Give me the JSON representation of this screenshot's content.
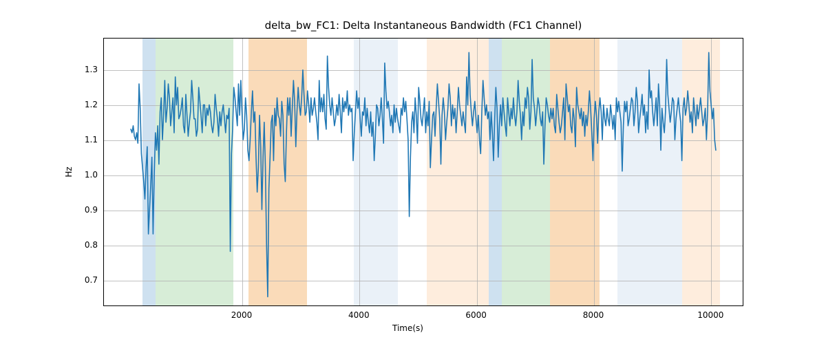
{
  "chart_data": {
    "type": "line",
    "title": "delta_bw_FC1: Delta Instantaneous Bandwidth (FC1 Channel)",
    "xlabel": "Time(s)",
    "ylabel": "Hz",
    "xlim": [
      -360,
      10560
    ],
    "ylim": [
      0.625,
      1.39
    ],
    "x_ticks": [
      2000,
      4000,
      6000,
      8000,
      10000
    ],
    "y_ticks": [
      0.7,
      0.8,
      0.9,
      1.0,
      1.1,
      1.2,
      1.3
    ],
    "x_tick_labels": [
      "2000",
      "4000",
      "6000",
      "8000",
      "10000"
    ],
    "y_tick_labels": [
      "0.7",
      "0.8",
      "0.9",
      "1.0",
      "1.1",
      "1.2",
      "1.3"
    ],
    "bands": [
      {
        "x0": 300,
        "x1": 520,
        "color": "#a6c8e4",
        "alpha": 0.55
      },
      {
        "x0": 520,
        "x1": 1850,
        "color": "#b6dfb6",
        "alpha": 0.55
      },
      {
        "x0": 2100,
        "x1": 3100,
        "color": "#f7c38b",
        "alpha": 0.6
      },
      {
        "x0": 3900,
        "x1": 4650,
        "color": "#d9e5f2",
        "alpha": 0.55
      },
      {
        "x0": 5150,
        "x1": 6200,
        "color": "#fde6cf",
        "alpha": 0.7
      },
      {
        "x0": 6200,
        "x1": 6430,
        "color": "#a6c8e4",
        "alpha": 0.55
      },
      {
        "x0": 6430,
        "x1": 7250,
        "color": "#b6dfb6",
        "alpha": 0.55
      },
      {
        "x0": 7250,
        "x1": 8100,
        "color": "#f7c38b",
        "alpha": 0.6
      },
      {
        "x0": 8400,
        "x1": 9500,
        "color": "#d9e5f2",
        "alpha": 0.55
      },
      {
        "x0": 9500,
        "x1": 10150,
        "color": "#fde6cf",
        "alpha": 0.7
      }
    ],
    "x": [
      100,
      120,
      140,
      160,
      180,
      200,
      220,
      240,
      260,
      280,
      300,
      320,
      340,
      360,
      380,
      400,
      420,
      440,
      460,
      480,
      500,
      520,
      540,
      560,
      580,
      600,
      620,
      640,
      660,
      680,
      700,
      720,
      740,
      760,
      780,
      800,
      820,
      840,
      860,
      880,
      900,
      920,
      940,
      960,
      980,
      1000,
      1020,
      1040,
      1060,
      1080,
      1100,
      1120,
      1140,
      1160,
      1180,
      1200,
      1220,
      1240,
      1260,
      1280,
      1300,
      1320,
      1340,
      1360,
      1380,
      1400,
      1420,
      1440,
      1460,
      1480,
      1500,
      1520,
      1540,
      1560,
      1580,
      1600,
      1620,
      1640,
      1660,
      1680,
      1700,
      1720,
      1740,
      1760,
      1780,
      1800,
      1820,
      1840,
      1860,
      1880,
      1900,
      1920,
      1940,
      1960,
      1980,
      2000,
      2020,
      2040,
      2060,
      2080,
      2100,
      2120,
      2140,
      2160,
      2180,
      2200,
      2220,
      2240,
      2260,
      2280,
      2300,
      2320,
      2340,
      2360,
      2380,
      2400,
      2420,
      2440,
      2460,
      2480,
      2500,
      2520,
      2540,
      2560,
      2580,
      2600,
      2620,
      2640,
      2660,
      2680,
      2700,
      2720,
      2740,
      2760,
      2780,
      2800,
      2820,
      2840,
      2860,
      2880,
      2900,
      2920,
      2940,
      2960,
      2980,
      3000,
      3020,
      3040,
      3060,
      3080,
      3100,
      3120,
      3140,
      3160,
      3180,
      3200,
      3220,
      3240,
      3260,
      3280,
      3300,
      3320,
      3340,
      3360,
      3380,
      3400,
      3420,
      3440,
      3460,
      3480,
      3500,
      3520,
      3540,
      3560,
      3580,
      3600,
      3620,
      3640,
      3660,
      3680,
      3700,
      3720,
      3740,
      3760,
      3780,
      3800,
      3820,
      3840,
      3860,
      3880,
      3900,
      3920,
      3940,
      3960,
      3980,
      4000,
      4020,
      4040,
      4060,
      4080,
      4100,
      4120,
      4140,
      4160,
      4180,
      4200,
      4220,
      4240,
      4260,
      4280,
      4300,
      4320,
      4340,
      4360,
      4380,
      4400,
      4420,
      4440,
      4460,
      4480,
      4500,
      4520,
      4540,
      4560,
      4580,
      4600,
      4620,
      4640,
      4660,
      4680,
      4700,
      4720,
      4740,
      4760,
      4780,
      4800,
      4820,
      4840,
      4860,
      4880,
      4900,
      4920,
      4940,
      4960,
      4980,
      5000,
      5020,
      5040,
      5060,
      5080,
      5100,
      5120,
      5140,
      5160,
      5180,
      5200,
      5220,
      5240,
      5260,
      5280,
      5300,
      5320,
      5340,
      5360,
      5380,
      5400,
      5420,
      5440,
      5460,
      5480,
      5500,
      5520,
      5540,
      5560,
      5580,
      5600,
      5620,
      5640,
      5660,
      5680,
      5700,
      5720,
      5740,
      5760,
      5780,
      5800,
      5820,
      5840,
      5860,
      5880,
      5900,
      5920,
      5940,
      5960,
      5980,
      6000,
      6020,
      6040,
      6060,
      6080,
      6100,
      6120,
      6140,
      6160,
      6180,
      6200,
      6220,
      6240,
      6260,
      6280,
      6300,
      6320,
      6340,
      6360,
      6380,
      6400,
      6420,
      6440,
      6460,
      6480,
      6500,
      6520,
      6540,
      6560,
      6580,
      6600,
      6620,
      6640,
      6660,
      6680,
      6700,
      6720,
      6740,
      6760,
      6780,
      6800,
      6820,
      6840,
      6860,
      6880,
      6900,
      6920,
      6940,
      6960,
      6980,
      7000,
      7020,
      7040,
      7060,
      7080,
      7100,
      7120,
      7140,
      7160,
      7180,
      7200,
      7220,
      7240,
      7260,
      7280,
      7300,
      7320,
      7340,
      7360,
      7380,
      7400,
      7420,
      7440,
      7460,
      7480,
      7500,
      7520,
      7540,
      7560,
      7580,
      7600,
      7620,
      7640,
      7660,
      7680,
      7700,
      7720,
      7740,
      7760,
      7780,
      7800,
      7820,
      7840,
      7860,
      7880,
      7900,
      7920,
      7940,
      7960,
      7980,
      8000,
      8020,
      8040,
      8060,
      8080,
      8100,
      8120,
      8140,
      8160,
      8180,
      8200,
      8220,
      8240,
      8260,
      8280,
      8300,
      8320,
      8340,
      8360,
      8380,
      8400,
      8420,
      8440,
      8460,
      8480,
      8500,
      8520,
      8540,
      8560,
      8580,
      8600,
      8620,
      8640,
      8660,
      8680,
      8700,
      8720,
      8740,
      8760,
      8780,
      8800,
      8820,
      8840,
      8860,
      8880,
      8900,
      8920,
      8940,
      8960,
      8980,
      9000,
      9020,
      9040,
      9060,
      9080,
      9100,
      9120,
      9140,
      9160,
      9180,
      9200,
      9220,
      9240,
      9260,
      9280,
      9300,
      9320,
      9340,
      9360,
      9380,
      9400,
      9420,
      9440,
      9460,
      9480,
      9500,
      9520,
      9540,
      9560,
      9580,
      9600,
      9620,
      9640,
      9660,
      9680,
      9700,
      9720,
      9740,
      9760,
      9780,
      9800,
      9820,
      9840,
      9860,
      9880,
      9900,
      9920,
      9940,
      9960,
      9980,
      10000,
      10020,
      10040,
      10060,
      10080,
      10100
    ],
    "values": [
      1.13,
      1.12,
      1.14,
      1.11,
      1.1,
      1.12,
      1.09,
      1.26,
      1.19,
      1.06,
      1.02,
      0.98,
      0.93,
      1.02,
      1.08,
      0.83,
      0.9,
      0.97,
      1.05,
      0.83,
      1.0,
      1.12,
      1.07,
      1.14,
      1.03,
      1.18,
      1.22,
      1.1,
      1.17,
      1.27,
      1.15,
      1.19,
      1.26,
      1.22,
      1.14,
      1.18,
      1.22,
      1.12,
      1.28,
      1.2,
      1.25,
      1.16,
      1.17,
      1.19,
      1.22,
      1.14,
      1.12,
      1.23,
      1.17,
      1.11,
      1.15,
      1.18,
      1.27,
      1.22,
      1.16,
      1.16,
      1.11,
      1.13,
      1.25,
      1.21,
      1.17,
      1.12,
      1.2,
      1.2,
      1.14,
      1.19,
      1.17,
      1.2,
      1.18,
      1.14,
      1.12,
      1.15,
      1.23,
      1.19,
      1.16,
      1.11,
      1.18,
      1.14,
      1.18,
      1.2,
      1.16,
      1.12,
      1.17,
      1.16,
      1.19,
      0.78,
      1.06,
      1.13,
      1.25,
      1.22,
      1.18,
      1.14,
      1.26,
      1.17,
      1.27,
      1.18,
      1.1,
      1.13,
      1.22,
      1.17,
      1.07,
      1.04,
      1.1,
      1.18,
      1.24,
      1.15,
      1.18,
      1.05,
      0.95,
      1.02,
      1.17,
      1.08,
      0.9,
      1.05,
      1.15,
      1.02,
      0.8,
      0.65,
      0.96,
      1.05,
      1.15,
      1.17,
      1.04,
      1.19,
      1.14,
      1.22,
      1.17,
      1.16,
      1.11,
      1.21,
      1.17,
      1.03,
      0.98,
      1.12,
      1.22,
      1.17,
      1.22,
      1.11,
      1.19,
      1.27,
      1.21,
      1.08,
      1.18,
      1.25,
      1.2,
      1.17,
      1.22,
      1.3,
      1.23,
      1.17,
      1.18,
      1.24,
      1.2,
      1.15,
      1.22,
      1.17,
      1.19,
      1.22,
      1.18,
      1.15,
      1.1,
      1.27,
      1.18,
      1.22,
      1.18,
      1.23,
      1.16,
      1.13,
      1.34,
      1.25,
      1.2,
      1.17,
      1.22,
      1.18,
      1.14,
      1.16,
      1.2,
      1.17,
      1.23,
      1.18,
      1.12,
      1.22,
      1.18,
      1.21,
      1.19,
      1.24,
      1.17,
      1.2,
      1.18,
      1.19,
      1.04,
      1.12,
      1.18,
      1.24,
      1.19,
      1.22,
      1.16,
      1.11,
      1.18,
      1.17,
      1.22,
      1.14,
      1.19,
      1.15,
      1.12,
      1.18,
      1.11,
      1.15,
      1.04,
      1.11,
      1.2,
      1.19,
      1.14,
      1.17,
      1.22,
      1.16,
      1.09,
      1.32,
      1.24,
      1.19,
      1.21,
      1.18,
      1.14,
      1.17,
      1.12,
      1.2,
      1.15,
      1.19,
      1.16,
      1.14,
      1.12,
      1.19,
      1.17,
      1.22,
      1.18,
      1.21,
      1.16,
      1.1,
      0.88,
      1.05,
      1.15,
      1.18,
      1.12,
      1.22,
      1.17,
      1.09,
      1.25,
      1.21,
      1.16,
      1.14,
      1.18,
      1.22,
      1.12,
      1.18,
      1.14,
      1.21,
      1.02,
      1.1,
      1.17,
      1.18,
      1.11,
      1.19,
      1.26,
      1.21,
      1.16,
      1.03,
      1.17,
      1.22,
      1.18,
      1.1,
      1.15,
      1.19,
      1.26,
      1.22,
      1.14,
      1.2,
      1.16,
      1.19,
      1.12,
      1.18,
      1.25,
      1.2,
      1.17,
      1.14,
      1.18,
      1.15,
      1.12,
      1.28,
      1.2,
      1.35,
      1.23,
      1.18,
      1.14,
      1.18,
      1.21,
      1.16,
      1.12,
      1.17,
      1.1,
      1.06,
      1.18,
      1.27,
      1.22,
      1.17,
      1.2,
      1.16,
      1.18,
      1.1,
      1.18,
      1.12,
      1.04,
      1.16,
      1.25,
      1.19,
      1.05,
      1.14,
      1.2,
      1.14,
      1.22,
      1.18,
      1.14,
      1.11,
      1.22,
      1.18,
      1.14,
      1.19,
      1.16,
      1.22,
      1.17,
      1.14,
      1.18,
      1.27,
      1.21,
      1.17,
      1.1,
      1.18,
      1.14,
      1.22,
      1.19,
      1.25,
      1.22,
      1.13,
      1.18,
      1.33,
      1.22,
      1.19,
      1.14,
      1.18,
      1.22,
      1.2,
      1.16,
      1.14,
      1.18,
      1.03,
      1.14,
      1.22,
      1.2,
      1.17,
      1.15,
      1.19,
      1.16,
      1.19,
      1.14,
      1.12,
      1.23,
      1.19,
      1.15,
      1.12,
      1.14,
      1.18,
      1.22,
      1.1,
      1.26,
      1.22,
      1.18,
      1.2,
      1.14,
      1.12,
      1.19,
      1.16,
      1.08,
      1.25,
      1.2,
      1.18,
      1.16,
      1.19,
      1.14,
      1.18,
      1.11,
      1.17,
      1.14,
      1.18,
      1.24,
      1.19,
      1.12,
      1.04,
      1.16,
      1.21,
      1.17,
      1.09,
      1.18,
      1.22,
      1.18,
      1.1,
      1.2,
      1.16,
      1.14,
      1.19,
      1.16,
      1.14,
      1.2,
      1.17,
      1.13,
      1.17,
      1.1,
      1.22,
      1.18,
      1.21,
      1.18,
      1.15,
      1.01,
      1.14,
      1.21,
      1.18,
      1.21,
      1.14,
      1.16,
      1.19,
      1.22,
      1.21,
      1.14,
      1.18,
      1.25,
      1.21,
      1.12,
      1.16,
      1.19,
      1.23,
      1.17,
      1.2,
      1.12,
      1.18,
      1.13,
      1.3,
      1.22,
      1.24,
      1.18,
      1.14,
      1.18,
      1.22,
      1.14,
      1.26,
      1.2,
      1.07,
      1.19,
      1.15,
      1.12,
      1.18,
      1.33,
      1.23,
      1.19,
      1.15,
      1.18,
      1.22,
      1.21,
      1.1,
      1.16,
      1.19,
      1.22,
      1.18,
      1.15,
      1.04,
      1.19,
      1.22,
      1.17,
      1.19,
      1.24,
      1.2,
      1.15,
      1.18,
      1.12,
      1.22,
      1.18,
      1.14,
      1.2,
      1.16,
      1.19,
      1.22,
      1.18,
      1.14,
      1.16,
      1.19,
      1.1,
      1.18,
      1.35,
      1.24,
      1.2,
      1.16,
      1.19,
      1.1,
      1.07
    ]
  },
  "layout": {
    "fig_w": 1200,
    "fig_h": 500,
    "axes_left": 150,
    "axes_top": 55,
    "axes_width": 930,
    "axes_height": 390
  }
}
